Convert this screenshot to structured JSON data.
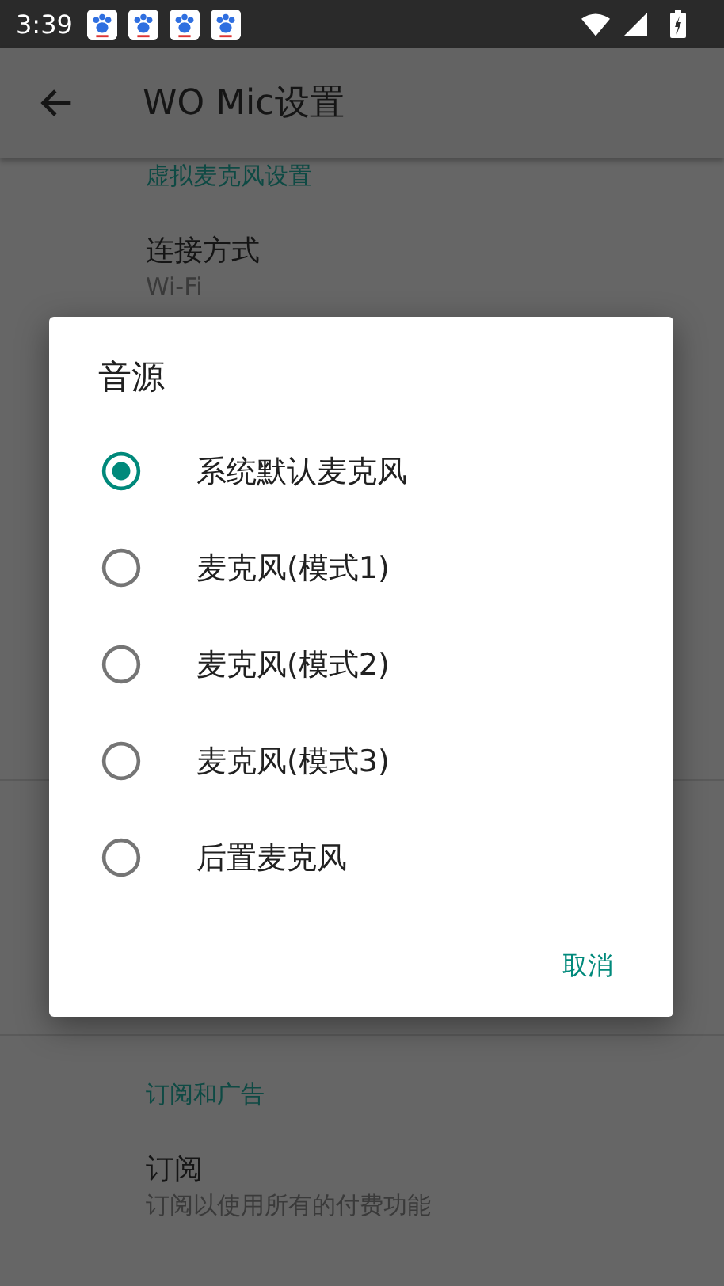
{
  "status_bar": {
    "time": "3:39"
  },
  "app_bar": {
    "title": "WO Mic设置"
  },
  "settings": [
    {
      "kind": "header",
      "title": "虚拟麦克风设置"
    },
    {
      "kind": "item",
      "title": "连接方式",
      "summary": "Wi-Fi"
    },
    {
      "kind": "divider"
    },
    {
      "kind": "header",
      "title": "订阅和广告"
    },
    {
      "kind": "item",
      "title": "订阅",
      "summary": "订阅以使用所有的付费功能"
    }
  ],
  "dialog": {
    "title": "音源",
    "options": [
      {
        "label": "系统默认麦克风",
        "selected": true
      },
      {
        "label": "麦克风(模式1)",
        "selected": false
      },
      {
        "label": "麦克风(模式2)",
        "selected": false
      },
      {
        "label": "麦克风(模式3)",
        "selected": false
      },
      {
        "label": "后置麦克风",
        "selected": false
      }
    ],
    "buttons": [
      "取消"
    ]
  }
}
